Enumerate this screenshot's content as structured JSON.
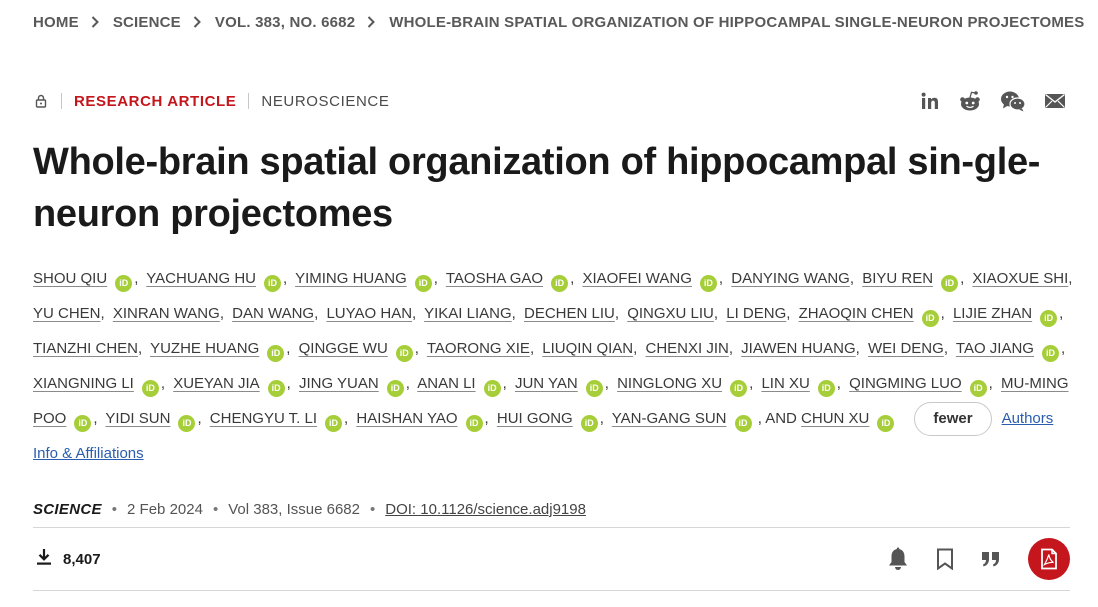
{
  "breadcrumb": [
    "HOME",
    "SCIENCE",
    "VOL. 383, NO. 6682",
    "WHOLE-BRAIN SPATIAL ORGANIZATION OF HIPPOCAMPAL SINGLE-NEURON PROJECTOMES"
  ],
  "article": {
    "type": "RESEARCH ARTICLE",
    "subject": "NEUROSCIENCE",
    "title": "Whole-brain spatial organization of hippocampal sin-gle-neuron projectomes"
  },
  "share_icons": [
    "linkedin-icon",
    "reddit-icon",
    "wechat-icon",
    "email-icon"
  ],
  "authors": [
    {
      "name": "SHOU QIU",
      "orcid": true
    },
    {
      "name": "YACHUANG HU",
      "orcid": true
    },
    {
      "name": "YIMING HUANG",
      "orcid": true
    },
    {
      "name": "TAOSHA GAO",
      "orcid": true
    },
    {
      "name": "XIAOFEI WANG",
      "orcid": true
    },
    {
      "name": "DANYING WANG",
      "orcid": false
    },
    {
      "name": "BIYU REN",
      "orcid": true
    },
    {
      "name": "XIAOXUE SHI",
      "orcid": false
    },
    {
      "name": "YU CHEN",
      "orcid": false
    },
    {
      "name": "XINRAN WANG",
      "orcid": false
    },
    {
      "name": "DAN WANG",
      "orcid": false
    },
    {
      "name": "LUYAO HAN",
      "orcid": false
    },
    {
      "name": "YIKAI LIANG",
      "orcid": false
    },
    {
      "name": "DECHEN LIU",
      "orcid": false
    },
    {
      "name": "QINGXU LIU",
      "orcid": false
    },
    {
      "name": "LI DENG",
      "orcid": false
    },
    {
      "name": "ZHAOQIN CHEN",
      "orcid": true
    },
    {
      "name": "LIJIE ZHAN",
      "orcid": true
    },
    {
      "name": "TIANZHI CHEN",
      "orcid": false
    },
    {
      "name": "YUZHE HUANG",
      "orcid": true
    },
    {
      "name": "QINGGE WU",
      "orcid": true
    },
    {
      "name": "TAORONG XIE",
      "orcid": false
    },
    {
      "name": "LIUQIN QIAN",
      "orcid": false
    },
    {
      "name": "CHENXI JIN",
      "orcid": false
    },
    {
      "name": "JIAWEN HUANG",
      "orcid": false
    },
    {
      "name": "WEI DENG",
      "orcid": false
    },
    {
      "name": "TAO JIANG",
      "orcid": true
    },
    {
      "name": "XIANGNING LI",
      "orcid": true
    },
    {
      "name": "XUEYAN JIA",
      "orcid": true
    },
    {
      "name": "JING YUAN",
      "orcid": true
    },
    {
      "name": "ANAN LI",
      "orcid": true
    },
    {
      "name": "JUN YAN",
      "orcid": true
    },
    {
      "name": "NINGLONG XU",
      "orcid": true
    },
    {
      "name": "LIN XU",
      "orcid": true
    },
    {
      "name": "QINGMING LUO",
      "orcid": true
    },
    {
      "name": "MU-MING POO",
      "orcid": true
    },
    {
      "name": "YIDI SUN",
      "orcid": true
    },
    {
      "name": "CHENGYU T. LI",
      "orcid": true
    },
    {
      "name": "HAISHAN YAO",
      "orcid": true
    },
    {
      "name": "HUI GONG",
      "orcid": true
    },
    {
      "name": "YAN-GANG SUN",
      "orcid": true
    },
    {
      "name": "CHUN XU",
      "orcid": true
    }
  ],
  "authors_and_label": ", AND",
  "orcid_label": "iD",
  "fewer_label": "fewer",
  "affiliations_label": "Authors Info & Affiliations",
  "meta": {
    "journal": "SCIENCE",
    "date": "2 Feb 2024",
    "issue": "Vol 383, Issue 6682",
    "doi": "DOI: 10.1126/science.adj9198",
    "separator": "•"
  },
  "downloads": "8,407",
  "toolbar_icons": [
    "bell-icon",
    "bookmark-icon",
    "quote-icon",
    "pdf-icon"
  ],
  "colors": {
    "accent": "#c4161c",
    "orcid": "#a6ce39",
    "link": "#2a5db0"
  }
}
